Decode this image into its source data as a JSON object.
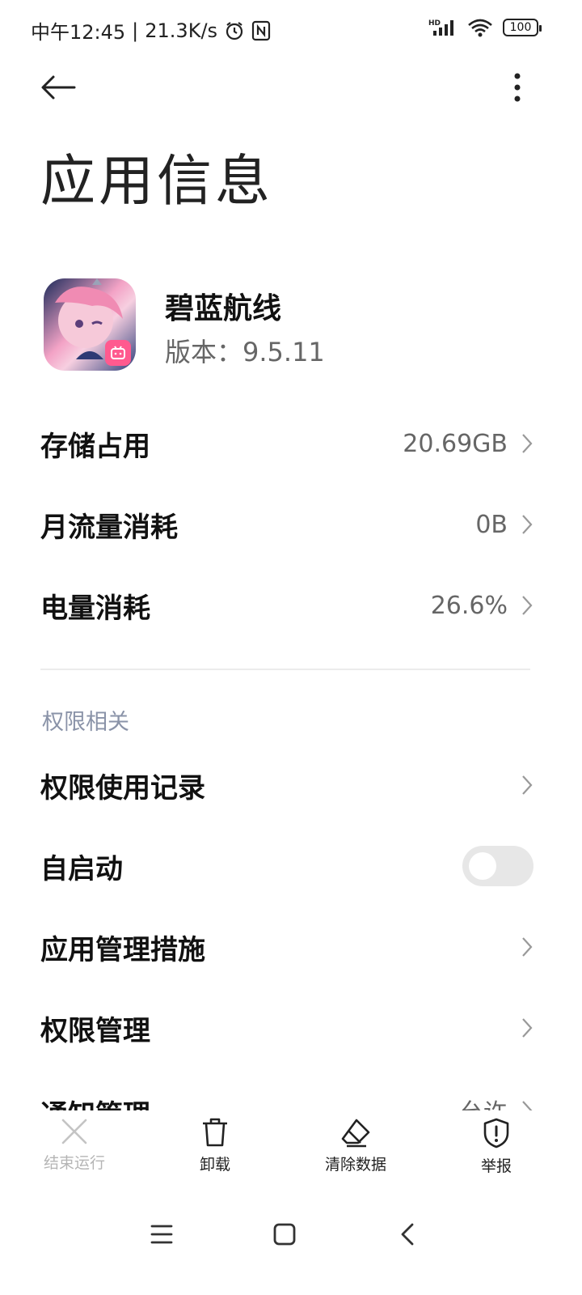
{
  "status_bar": {
    "time": "中午12:45",
    "separator": "|",
    "network_speed": "21.3K/s",
    "battery": "100",
    "icons": [
      "alarm-icon",
      "nfc-icon",
      "hd-signal-icon",
      "wifi-icon",
      "battery-icon"
    ]
  },
  "header": {
    "title": "应用信息"
  },
  "app": {
    "name": "碧蓝航线",
    "version": "版本：9.5.11"
  },
  "usage": [
    {
      "label": "存储占用",
      "value": "20.69GB"
    },
    {
      "label": "月流量消耗",
      "value": "0B"
    },
    {
      "label": "电量消耗",
      "value": "26.6%"
    }
  ],
  "permissions": {
    "section_title": "权限相关",
    "items": [
      {
        "label": "权限使用记录"
      },
      {
        "label": "自启动",
        "toggle": false
      },
      {
        "label": "应用管理措施"
      },
      {
        "label": "权限管理"
      },
      {
        "label": "通知管理",
        "value": "允许"
      }
    ]
  },
  "actions": [
    {
      "label": "结束运行",
      "icon": "close-icon",
      "enabled": false
    },
    {
      "label": "卸载",
      "icon": "trash-icon",
      "enabled": true
    },
    {
      "label": "清除数据",
      "icon": "eraser-icon",
      "enabled": true
    },
    {
      "label": "举报",
      "icon": "shield-alert-icon",
      "enabled": true
    }
  ],
  "colors": {
    "section_title": "#8a93a8",
    "toggle_off": "#e7e7e7",
    "disabled_text": "#b5b5b5"
  }
}
